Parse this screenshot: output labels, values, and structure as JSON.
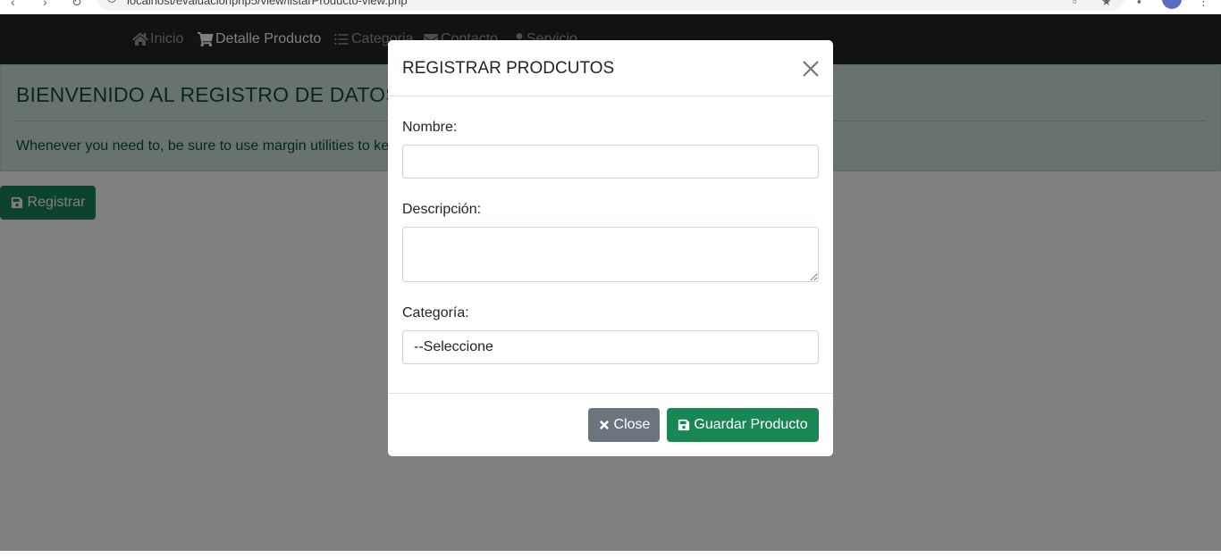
{
  "browser": {
    "url": "localhost/evaluacionphp5/view/listarProducto-view.php"
  },
  "navbar": {
    "items": [
      {
        "label": "Inicio",
        "icon": "home-icon"
      },
      {
        "label": "Detalle Producto",
        "icon": "cart-icon"
      },
      {
        "label": "Categoria",
        "icon": "list-icon"
      },
      {
        "label": "Contacto",
        "icon": "envelope-icon"
      },
      {
        "label": "Servicio",
        "icon": "user-icon"
      }
    ]
  },
  "jumbotron": {
    "title": "BIENVENIDO AL REGISTRO DE DATOS",
    "text": "Whenever you need to, be sure to use margin utilities to ke"
  },
  "register_button": {
    "label": "Registrar",
    "icon": "save-icon"
  },
  "modal": {
    "title": "REGISTRAR PRODCUTOS",
    "fields": {
      "nombre_label": "Nombre:",
      "nombre_value": "",
      "descripcion_label": "Descripción:",
      "descripcion_value": "",
      "categoria_label": "Categoría:",
      "categoria_selected": "--Seleccione"
    },
    "buttons": {
      "close_label": "Close",
      "save_label": "Guardar Producto"
    }
  },
  "colors": {
    "navbar_bg": "#212529",
    "success": "#198754",
    "secondary": "#6c757d",
    "alert_bg": "#d1e7dd",
    "alert_text": "#0f5132"
  }
}
